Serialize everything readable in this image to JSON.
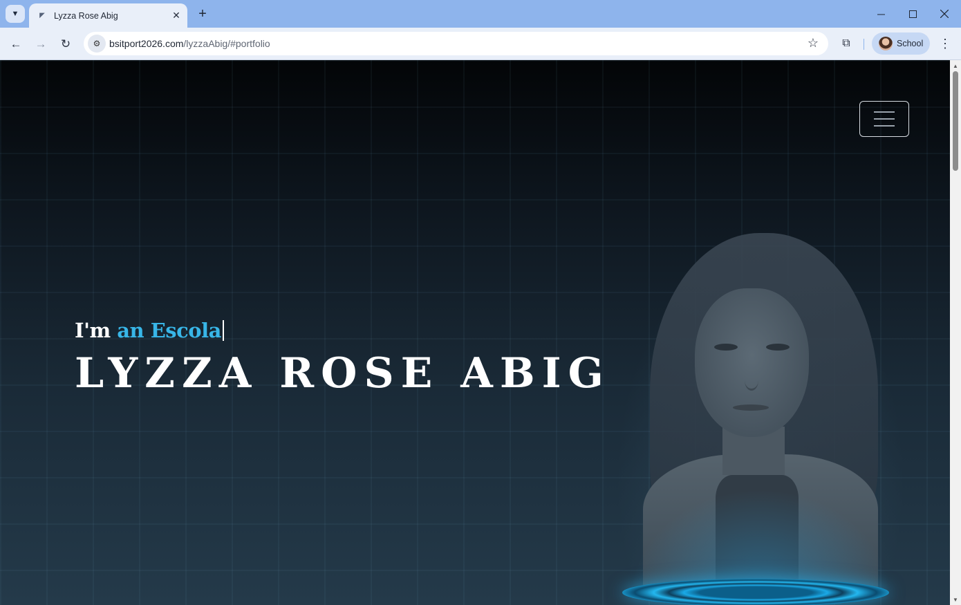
{
  "browser": {
    "tab_title": "Lyzza Rose Abig",
    "url_domain": "bsitport2026.com",
    "url_path": "/lyzzaAbig/#portfolio",
    "profile_label": "School",
    "icons": {
      "tab_search": "chevron-down-icon",
      "favicon": "page-icon",
      "close": "close-icon",
      "new_tab": "plus-icon",
      "back": "arrow-left-icon",
      "forward": "arrow-right-icon",
      "reload": "reload-icon",
      "site_info": "tune-icon",
      "bookmark": "star-icon",
      "extensions": "puzzle-icon",
      "menu": "more-vertical-icon"
    },
    "colors": {
      "titlebar": "#8eb4ec",
      "toolbar": "#e9eff9"
    }
  },
  "page": {
    "intro_prefix": "I'm ",
    "intro_typed": "an Escola",
    "name": "LYZZA ROSE ABIG",
    "colors": {
      "accent": "#38b6e8",
      "text": "#ffffff"
    },
    "menu_icon": "hamburger-icon"
  }
}
